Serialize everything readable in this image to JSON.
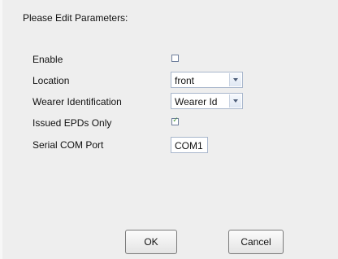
{
  "dialog": {
    "title": "Please Edit Parameters:",
    "buttons": {
      "ok": "OK",
      "cancel": "Cancel"
    }
  },
  "params": {
    "enable": {
      "label": "Enable",
      "checked": false
    },
    "location": {
      "label": "Location",
      "value": "front"
    },
    "wearer": {
      "label": "Wearer Identification",
      "value": "Wearer Id"
    },
    "epds": {
      "label": "Issued EPDs Only",
      "checked": true
    },
    "com": {
      "label": "Serial COM Port",
      "value": "COM1"
    }
  },
  "icons": {
    "dropdown": "chevron-down-icon",
    "check": "checkmark-icon"
  }
}
